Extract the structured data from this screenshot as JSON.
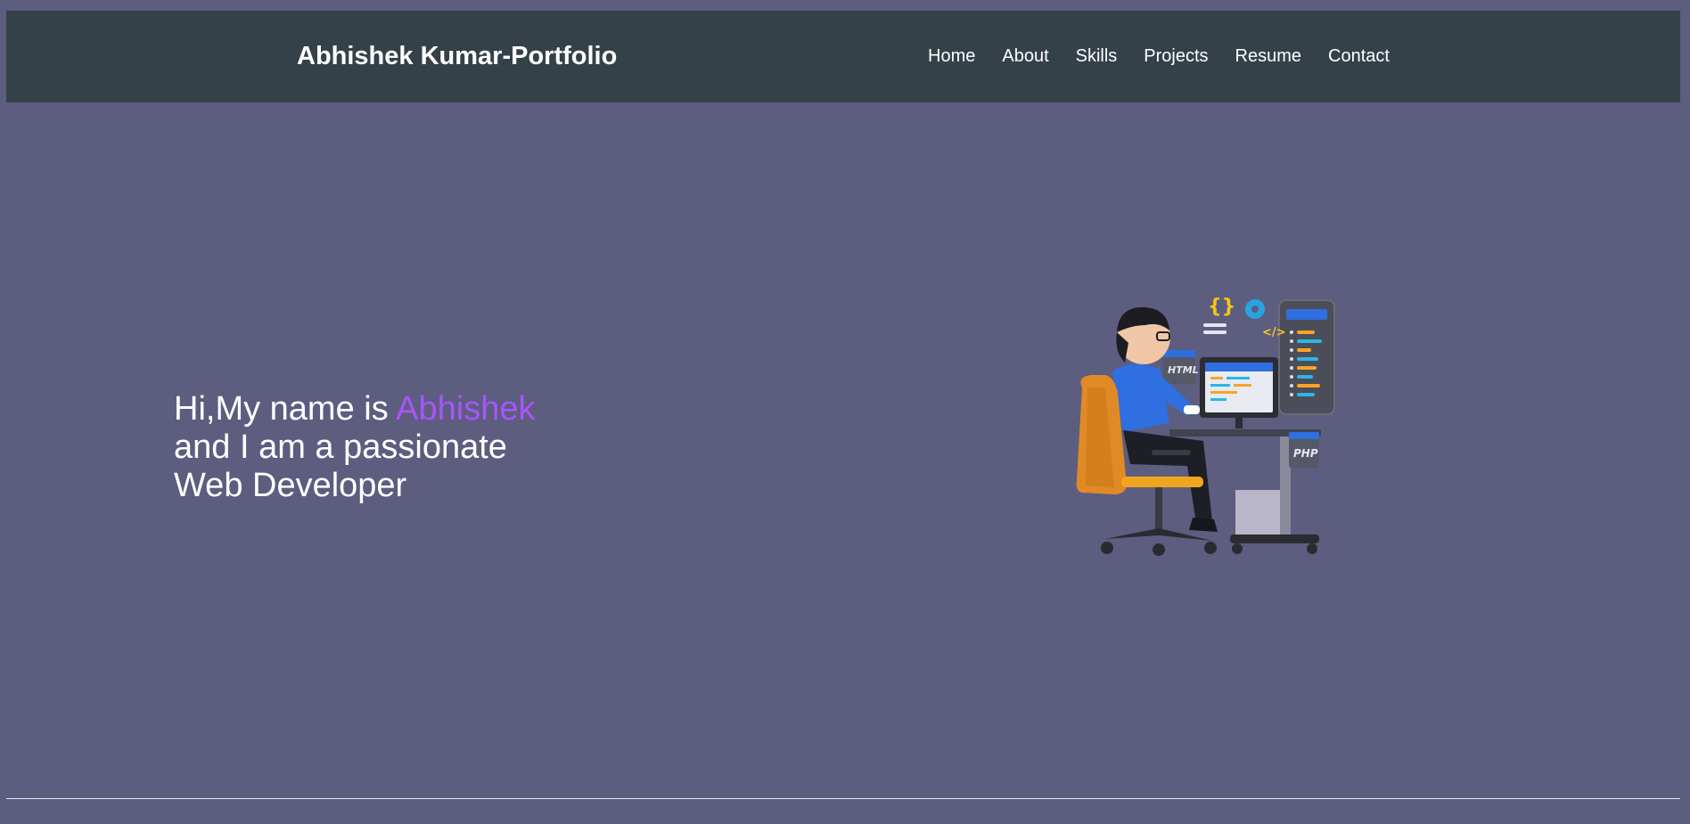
{
  "header": {
    "brand": "Abhishek Kumar-Portfolio",
    "nav": [
      {
        "label": "Home"
      },
      {
        "label": "About"
      },
      {
        "label": "Skills"
      },
      {
        "label": "Projects"
      },
      {
        "label": "Resume"
      },
      {
        "label": "Contact"
      }
    ]
  },
  "hero": {
    "intro_prefix": "Hi,My name is ",
    "intro_name": "Abhishek",
    "line2": "and I am a passionate",
    "line3": "Web Developer",
    "illustration_labels": {
      "html": "HTML",
      "php": "PHP",
      "braces": "{}",
      "code_tag": "</>"
    }
  },
  "colors": {
    "background": "#5d5d80",
    "navbar": "#354149",
    "accent_name": "#a855f7",
    "text": "#ffffff"
  }
}
